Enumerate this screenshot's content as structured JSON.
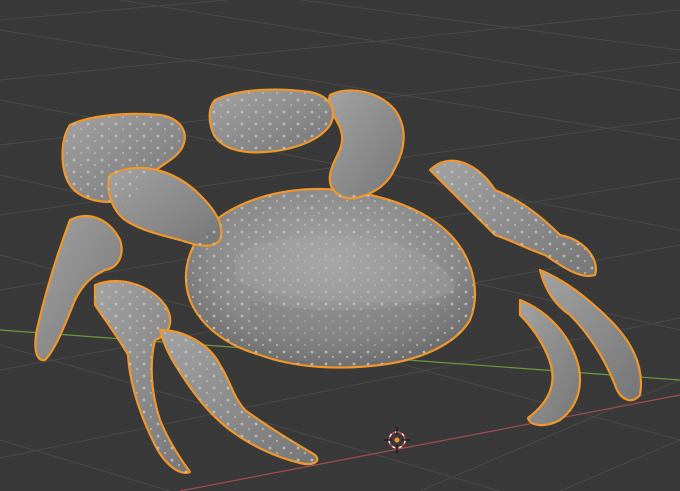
{
  "viewport": {
    "mode": "3d-viewport",
    "background_color": "#393939",
    "grid_color": "#4a4a4a",
    "x_axis_color": "#a34b55",
    "y_axis_color": "#6b9a3a",
    "selection_outline_color": "#f0962a",
    "mesh_color": "#8f8f8f"
  },
  "selected_object": {
    "icon": "crab-mesh-icon",
    "selected": true
  },
  "origin_marker": {
    "icon": "3d-cursor-icon"
  }
}
